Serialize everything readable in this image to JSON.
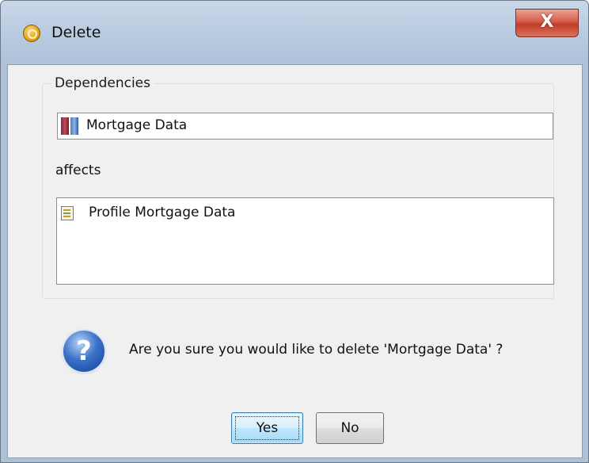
{
  "window": {
    "title": "Delete",
    "close_label": "X"
  },
  "dependencies": {
    "group_label": "Dependencies",
    "item": "Mortgage Data",
    "affects_label": "affects",
    "affected_items": [
      "Profile Mortgage Data"
    ]
  },
  "prompt": {
    "icon": "question-icon",
    "glyph": "?",
    "message": "Are you sure you would like to delete 'Mortgage Data' ?"
  },
  "buttons": {
    "yes": "Yes",
    "no": "No"
  },
  "colors": {
    "close_button": "#c7432e",
    "default_button_border": "#3c7fb1",
    "question_icon": "#2a5db4"
  }
}
